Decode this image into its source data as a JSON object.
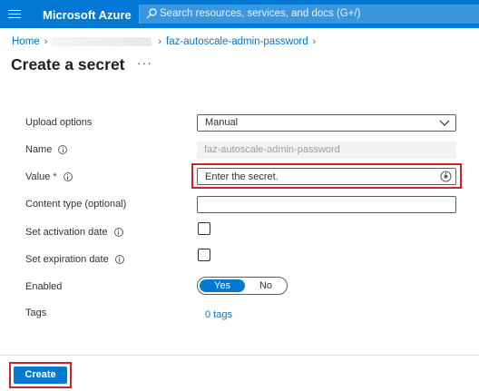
{
  "topbar": {
    "brand": "Microsoft Azure",
    "search_placeholder": "Search resources, services, and docs (G+/)"
  },
  "breadcrumb": {
    "home": "Home",
    "current": "faz-autoscale-admin-password"
  },
  "page": {
    "title": "Create a secret",
    "more": "···"
  },
  "form": {
    "upload_options": {
      "label": "Upload options",
      "value": "Manual"
    },
    "name": {
      "label": "Name",
      "value": "faz-autoscale-admin-password"
    },
    "value": {
      "label": "Value",
      "required_mark": "*",
      "placeholder": "Enter the secret."
    },
    "content_type": {
      "label": "Content type (optional)",
      "value": ""
    },
    "activation": {
      "label": "Set activation date"
    },
    "expiration": {
      "label": "Set expiration date"
    },
    "enabled": {
      "label": "Enabled",
      "yes": "Yes",
      "no": "No",
      "selected": "Yes"
    },
    "tags": {
      "label": "Tags",
      "value": "0 tags"
    }
  },
  "footer": {
    "create_label": "Create"
  },
  "colors": {
    "accent": "#0078d4",
    "highlight": "#c4262e"
  }
}
